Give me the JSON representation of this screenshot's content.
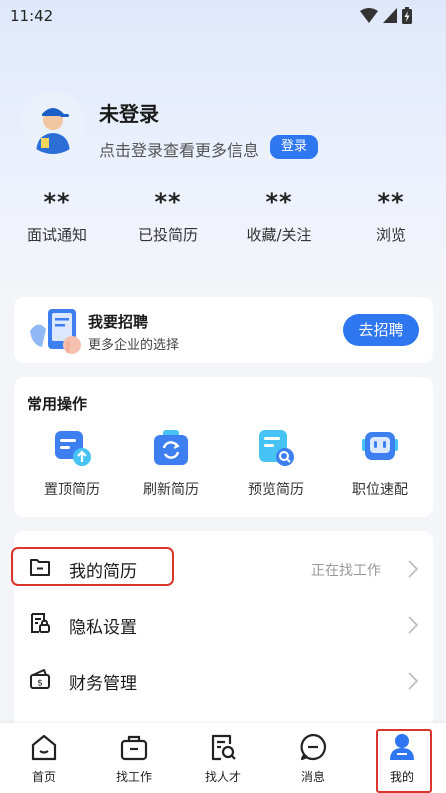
{
  "status_bar": {
    "time": "11:42"
  },
  "profile": {
    "name": "未登录",
    "subtitle": "点击登录查看更多信息",
    "login_button": "登录"
  },
  "stats": [
    {
      "value": "**",
      "label": "面试通知"
    },
    {
      "value": "**",
      "label": "已投简历"
    },
    {
      "value": "**",
      "label": "收藏/关注"
    },
    {
      "value": "**",
      "label": "浏览"
    }
  ],
  "recruit": {
    "title": "我要招聘",
    "subtitle": "更多企业的选择",
    "button": "去招聘"
  },
  "common_ops": {
    "title": "常用操作",
    "items": [
      {
        "label": "置顶简历",
        "icon": "resume-top-icon"
      },
      {
        "label": "刷新简历",
        "icon": "refresh-resume-icon"
      },
      {
        "label": "预览简历",
        "icon": "preview-resume-icon"
      },
      {
        "label": "职位速配",
        "icon": "job-match-icon"
      }
    ]
  },
  "menu": [
    {
      "label": "我的简历",
      "status": "正在找工作",
      "icon": "folder-icon"
    },
    {
      "label": "隐私设置",
      "status": "",
      "icon": "lock-doc-icon"
    },
    {
      "label": "财务管理",
      "status": "",
      "icon": "wallet-icon"
    }
  ],
  "tabbar": [
    {
      "label": "首页",
      "icon": "home-icon"
    },
    {
      "label": "找工作",
      "icon": "briefcase-icon"
    },
    {
      "label": "找人才",
      "icon": "search-doc-icon"
    },
    {
      "label": "消息",
      "icon": "message-icon"
    },
    {
      "label": "我的",
      "icon": "user-icon",
      "active": true
    }
  ],
  "colors": {
    "accent": "#2f76f1",
    "highlight": "#d9352b"
  }
}
